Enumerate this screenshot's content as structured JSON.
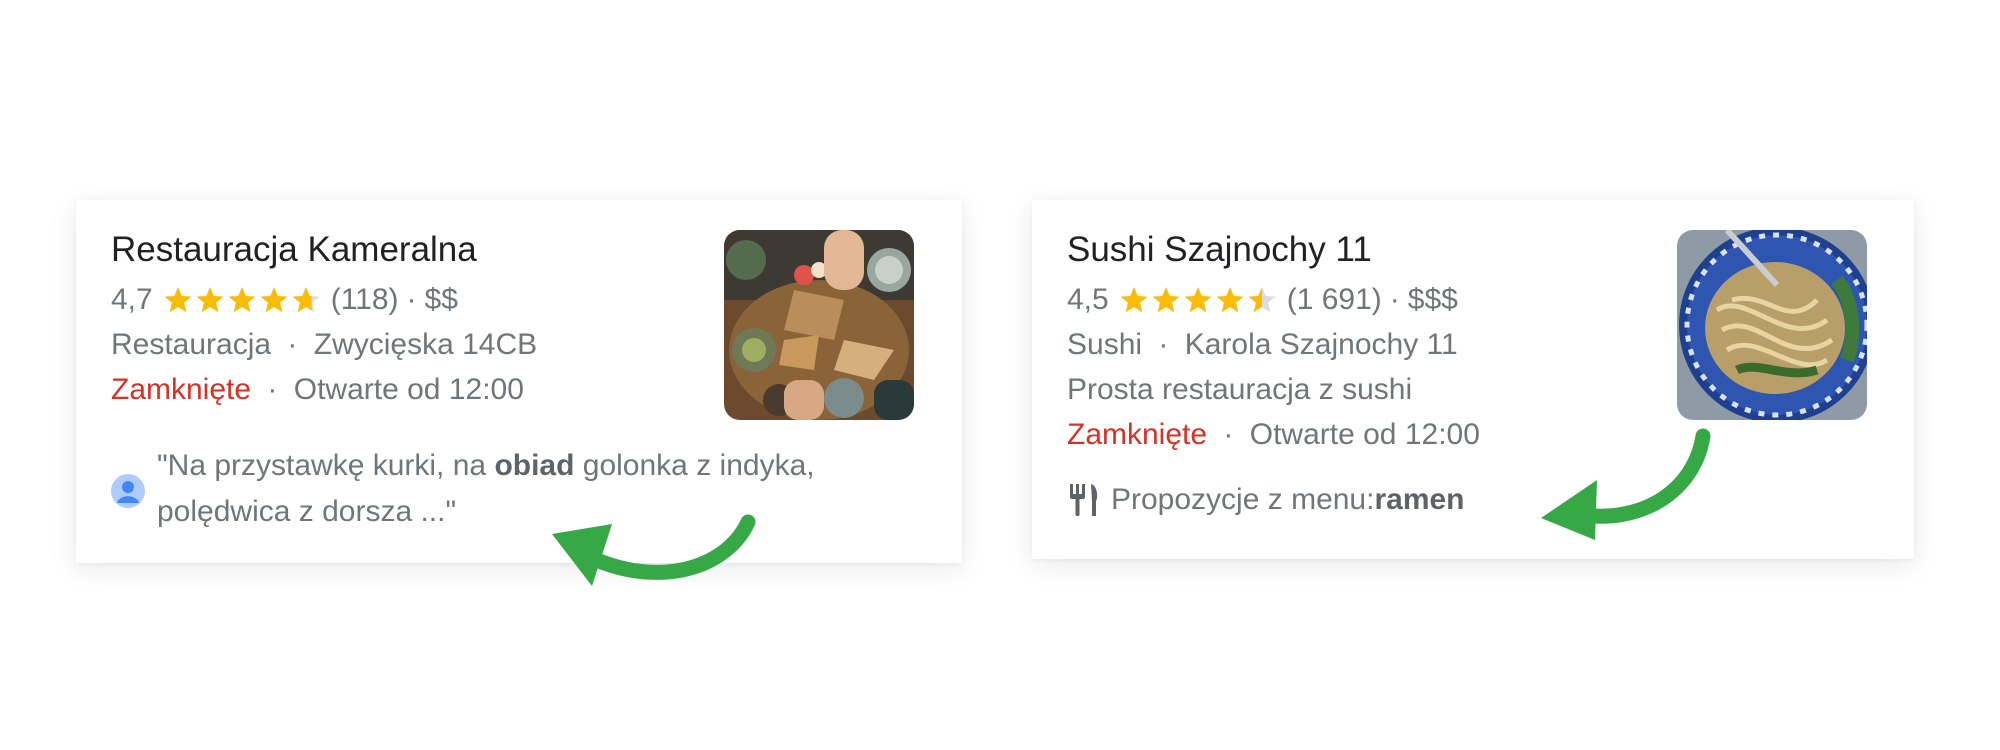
{
  "cards": [
    {
      "name": "Restauracja Kameralna",
      "rating": "4,7",
      "stars": 4.7,
      "reviews": "(118)",
      "price": "$$",
      "sep": "·",
      "category": "Restauracja",
      "address": "Zwycięska 14CB",
      "status": "Zamknięte",
      "hours": "Otwarte od 12:00",
      "review_parts": [
        "\"Na przystawkę kurki, na ",
        "obiad",
        " golonka z indyka, polędwica z dorsza ...\""
      ]
    },
    {
      "name": "Sushi Szajnochy 11",
      "rating": "4,5",
      "stars": 4.5,
      "reviews": "(1 691)",
      "price": "$$$",
      "sep": "·",
      "category": "Sushi",
      "address": "Karola Szajnochy 11",
      "description": "Prosta restauracja z sushi",
      "status": "Zamknięte",
      "hours": "Otwarte od 12:00",
      "menu_label": "Propozycje z menu: ",
      "menu_item": "ramen"
    }
  ],
  "colors": {
    "star": "#fbbc04",
    "star_empty": "#dadce0",
    "closed": "#d93025",
    "arrow": "#37a846"
  },
  "icons": [
    "star-icon",
    "avatar-icon",
    "cutlery-icon",
    "curved-arrow"
  ]
}
